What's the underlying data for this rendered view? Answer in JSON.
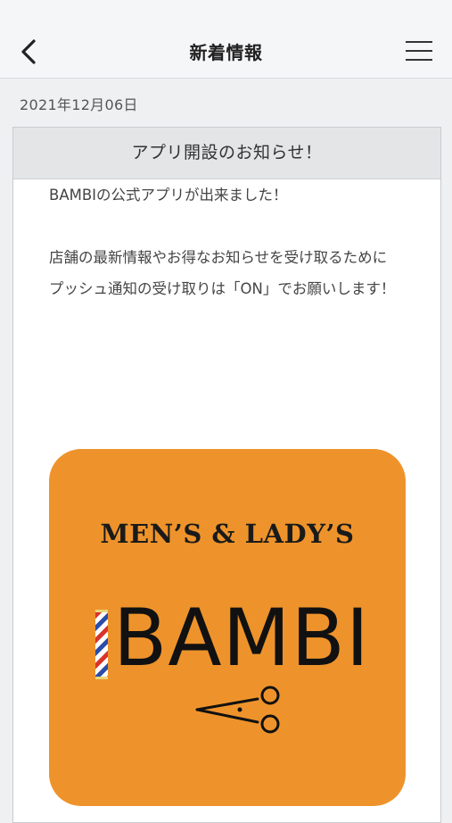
{
  "header": {
    "back_icon": "chevron-left-icon",
    "title": "新着情報",
    "menu_icon": "hamburger-menu-icon"
  },
  "news": {
    "date": "2021年12月06日",
    "title": "アプリ開設のお知らせ！",
    "paragraph1": "BAMBIの公式アプリが出来ました！",
    "paragraph2_line1": "店舗の最新情報やお得なお知らせを受け取るために",
    "paragraph2_line2": "プッシュ通知の受け取りは「ON」でお願いします！",
    "image": {
      "top_text": "MEN’S & LADY’S",
      "brand_name": "BAMBI",
      "background_color": "#ee932b",
      "icons": [
        "barber-pole-icon",
        "scissors-icon"
      ]
    }
  }
}
